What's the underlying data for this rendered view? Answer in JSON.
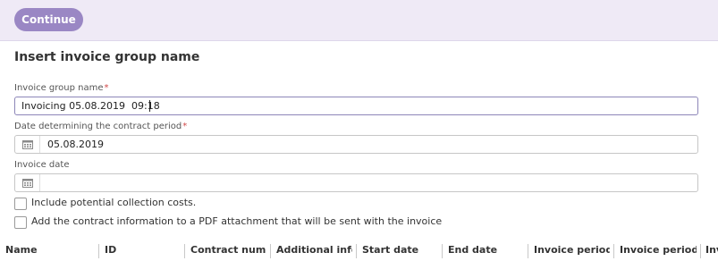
{
  "toolbar": {
    "continue_label": "Continue"
  },
  "form": {
    "title": "Insert invoice group name",
    "required_marker": "*",
    "invoice_group_name": {
      "label": "Invoice group name",
      "value": "Invoicing 05.08.2019  09:18"
    },
    "contract_period_date": {
      "label": "Date determining the contract period",
      "value": "05.08.2019",
      "icon": "calendar-icon"
    },
    "invoice_date": {
      "label": "Invoice date",
      "value": "",
      "icon": "calendar-icon"
    },
    "checkboxes": [
      {
        "label": "Include potential collection costs.",
        "checked": false
      },
      {
        "label": "Add the contract information to a PDF attachment that will be sent with the invoice",
        "checked": false
      }
    ]
  },
  "table": {
    "columns": [
      "Name",
      "ID",
      "Contract numbe",
      "Additional infor",
      "Start date",
      "End date",
      "Invoice period",
      "Invoice period s",
      "Inv"
    ]
  },
  "colors": {
    "accent": "#9a87c4",
    "topbar_bg": "#efeaf6",
    "required": "#d04848"
  }
}
